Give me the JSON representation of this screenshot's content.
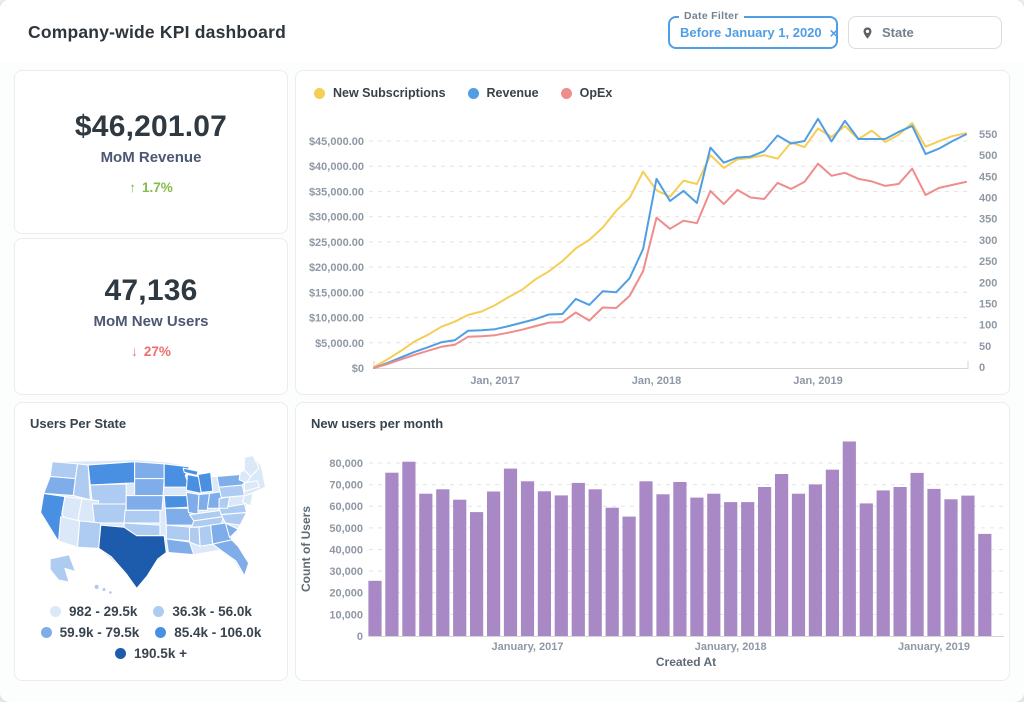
{
  "header": {
    "title": "Company-wide KPI dashboard"
  },
  "filters": {
    "date": {
      "label": "Date Filter",
      "value": "Before January 1, 2020",
      "clear_icon": "×"
    },
    "state": {
      "label": "State"
    }
  },
  "scorecards": [
    {
      "value": "$46,201.07",
      "label": "MoM Revenue",
      "arrow": "↑",
      "change": "1.7%",
      "trend": "up",
      "color": "#84bb4c"
    },
    {
      "value": "47,136",
      "label": "MoM New Users",
      "arrow": "↓",
      "change": "27%",
      "trend": "down",
      "color": "#ed6e6e"
    }
  ],
  "chart_data": [
    {
      "id": "kpi-trend",
      "type": "line",
      "title": "",
      "legend_position": "top-left",
      "grid": "dashed-horizontal",
      "x_months": [
        "2016-04",
        "2016-05",
        "2016-06",
        "2016-07",
        "2016-08",
        "2016-09",
        "2016-10",
        "2016-11",
        "2016-12",
        "2017-01",
        "2017-02",
        "2017-03",
        "2017-04",
        "2017-05",
        "2017-06",
        "2017-07",
        "2017-08",
        "2017-09",
        "2017-10",
        "2017-11",
        "2017-12",
        "2018-01",
        "2018-02",
        "2018-03",
        "2018-04",
        "2018-05",
        "2018-06",
        "2018-07",
        "2018-08",
        "2018-09",
        "2018-10",
        "2018-11",
        "2018-12",
        "2019-01",
        "2019-02",
        "2019-03",
        "2019-04",
        "2019-05",
        "2019-06",
        "2019-07",
        "2019-08",
        "2019-09",
        "2019-10",
        "2019-11",
        "2019-12"
      ],
      "x_ticks": [
        {
          "index": 9,
          "label": "Jan, 2017"
        },
        {
          "index": 21,
          "label": "Jan, 2018"
        },
        {
          "index": 33,
          "label": "Jan, 2019"
        }
      ],
      "left_axis": {
        "max": 45000,
        "tick_values": [
          0,
          5000,
          10000,
          15000,
          20000,
          25000,
          30000,
          35000,
          40000,
          45000
        ],
        "tick_labels": [
          "$0",
          "$5,000.00",
          "$10,000.00",
          "$15,000.00",
          "$20,000.00",
          "$25,000.00",
          "$30,000.00",
          "$35,000.00",
          "$40,000.00",
          "$45,000.00"
        ]
      },
      "right_axis": {
        "max": 550,
        "tick_values": [
          0,
          50,
          100,
          150,
          200,
          250,
          300,
          350,
          400,
          450,
          500,
          550
        ],
        "tick_labels": [
          "0",
          "50",
          "100",
          "150",
          "200",
          "250",
          "300",
          "350",
          "400",
          "450",
          "500",
          "550"
        ]
      },
      "series": [
        {
          "name": "New Subscriptions",
          "color": "#f5ce56",
          "axis": "right",
          "values": [
            0,
            18,
            38,
            60,
            76,
            95,
            107,
            123,
            131,
            146,
            165,
            182,
            207,
            226,
            250,
            280,
            300,
            329,
            369,
            399,
            461,
            417,
            402,
            440,
            432,
            500,
            470,
            490,
            494,
            500,
            492,
            530,
            519,
            563,
            543,
            569,
            538,
            558,
            531,
            548,
            576,
            520,
            533,
            545,
            552
          ]
        },
        {
          "name": "Revenue",
          "color": "#509ee3",
          "axis": "left",
          "values": [
            0,
            1000,
            2100,
            3200,
            4100,
            5100,
            5500,
            7400,
            7500,
            7700,
            8300,
            9000,
            9700,
            10600,
            10700,
            13700,
            12500,
            15200,
            15000,
            17800,
            23600,
            37500,
            33100,
            35100,
            32700,
            43700,
            40700,
            41700,
            41900,
            43000,
            46100,
            44500,
            45000,
            49400,
            44900,
            49000,
            45400,
            45400,
            45400,
            46800,
            48000,
            42400,
            43500,
            45000,
            46300
          ]
        },
        {
          "name": "OpEx",
          "color": "#ef8c8c",
          "axis": "left",
          "values": [
            0,
            800,
            1700,
            2600,
            3400,
            4200,
            4600,
            6200,
            6300,
            6500,
            7000,
            7600,
            8300,
            9000,
            9100,
            11000,
            9400,
            12000,
            11900,
            14300,
            19200,
            29800,
            27600,
            29200,
            28700,
            35100,
            32500,
            35300,
            33800,
            33500,
            36700,
            35500,
            36900,
            40500,
            38100,
            38700,
            37500,
            37000,
            36100,
            36500,
            39500,
            34300,
            35700,
            36300,
            36900
          ]
        }
      ]
    },
    {
      "id": "users-per-state",
      "type": "choropleth",
      "title": "Users Per State",
      "legend": [
        {
          "label": "982 - 29.5k",
          "color": "#dbe8f8"
        },
        {
          "label": "36.3k - 56.0k",
          "color": "#aecbf1"
        },
        {
          "label": "59.9k - 79.5k",
          "color": "#7fade9"
        },
        {
          "label": "85.4k - 106.0k",
          "color": "#4990e2"
        },
        {
          "label": "190.5k +",
          "color": "#1d5bad"
        }
      ],
      "states": [
        {
          "code": "WA",
          "shade": 2
        },
        {
          "code": "OR",
          "shade": 3
        },
        {
          "code": "CA",
          "shade": 4
        },
        {
          "code": "NV",
          "shade": 1
        },
        {
          "code": "ID",
          "shade": 2
        },
        {
          "code": "MT",
          "shade": 4
        },
        {
          "code": "WY",
          "shade": 2
        },
        {
          "code": "UT",
          "shade": 1
        },
        {
          "code": "CO",
          "shade": 2
        },
        {
          "code": "AZ",
          "shade": 1
        },
        {
          "code": "NM",
          "shade": 2
        },
        {
          "code": "ND",
          "shade": 3
        },
        {
          "code": "SD",
          "shade": 3
        },
        {
          "code": "NE",
          "shade": 3
        },
        {
          "code": "KS",
          "shade": 2
        },
        {
          "code": "OK",
          "shade": 2
        },
        {
          "code": "TX",
          "shade": 5
        },
        {
          "code": "MN",
          "shade": 4
        },
        {
          "code": "IA",
          "shade": 4
        },
        {
          "code": "MO",
          "shade": 3
        },
        {
          "code": "AR",
          "shade": 2
        },
        {
          "code": "LA",
          "shade": 3
        },
        {
          "code": "WI",
          "shade": 4
        },
        {
          "code": "MI",
          "shade": 4
        },
        {
          "code": "IL",
          "shade": 3
        },
        {
          "code": "IN",
          "shade": 3
        },
        {
          "code": "OH",
          "shade": 3
        },
        {
          "code": "KY",
          "shade": 2
        },
        {
          "code": "TN",
          "shade": 2
        },
        {
          "code": "MS",
          "shade": 2
        },
        {
          "code": "AL",
          "shade": 2
        },
        {
          "code": "GA",
          "shade": 3
        },
        {
          "code": "FL",
          "shade": 3
        },
        {
          "code": "SC",
          "shade": 3
        },
        {
          "code": "NC",
          "shade": 2
        },
        {
          "code": "VA",
          "shade": 2
        },
        {
          "code": "WV",
          "shade": 2
        },
        {
          "code": "PA",
          "shade": 2
        },
        {
          "code": "NY",
          "shade": 3
        },
        {
          "code": "ME",
          "shade": 1
        },
        {
          "code": "VTNH",
          "shade": 1
        },
        {
          "code": "MACTRI",
          "shade": 1
        },
        {
          "code": "NJMDDE",
          "shade": 1
        },
        {
          "code": "AK",
          "shade": 2
        },
        {
          "code": "HI",
          "shade": 2
        }
      ]
    },
    {
      "id": "new-users-per-month",
      "type": "bar",
      "title": "New users per month",
      "xlabel": "Created At",
      "ylabel": "Count of Users",
      "bar_color": "#a989c5",
      "ylim": [
        0,
        90000
      ],
      "y_axis": {
        "tick_values": [
          0,
          10000,
          20000,
          30000,
          40000,
          50000,
          60000,
          70000,
          80000
        ],
        "tick_labels": [
          "0",
          "10,000",
          "20,000",
          "30,000",
          "40,000",
          "50,000",
          "60,000",
          "70,000",
          "80,000"
        ]
      },
      "x_months": [
        "2016-04",
        "2016-05",
        "2016-06",
        "2016-07",
        "2016-08",
        "2016-09",
        "2016-10",
        "2016-11",
        "2016-12",
        "2017-01",
        "2017-02",
        "2017-03",
        "2017-04",
        "2017-05",
        "2017-06",
        "2017-07",
        "2017-08",
        "2017-09",
        "2017-10",
        "2017-11",
        "2017-12",
        "2018-01",
        "2018-02",
        "2018-03",
        "2018-04",
        "2018-05",
        "2018-06",
        "2018-07",
        "2018-08",
        "2018-09",
        "2018-10",
        "2018-11",
        "2018-12",
        "2019-01",
        "2019-02",
        "2019-03",
        "2019-04"
      ],
      "x_ticks": [
        {
          "index": 9,
          "label": "January, 2017"
        },
        {
          "index": 21,
          "label": "January, 2018"
        },
        {
          "index": 33,
          "label": "January, 2019"
        }
      ],
      "values": [
        25500,
        75500,
        80600,
        65800,
        67800,
        63000,
        57300,
        66800,
        77400,
        71500,
        66900,
        65000,
        70800,
        67800,
        59300,
        55200,
        71500,
        65500,
        71200,
        64000,
        65800,
        61900,
        61900,
        68900,
        74900,
        65800,
        70100,
        76900,
        89900,
        61300,
        67300,
        68900,
        75400,
        68000,
        63200,
        64900,
        47200
      ]
    }
  ]
}
